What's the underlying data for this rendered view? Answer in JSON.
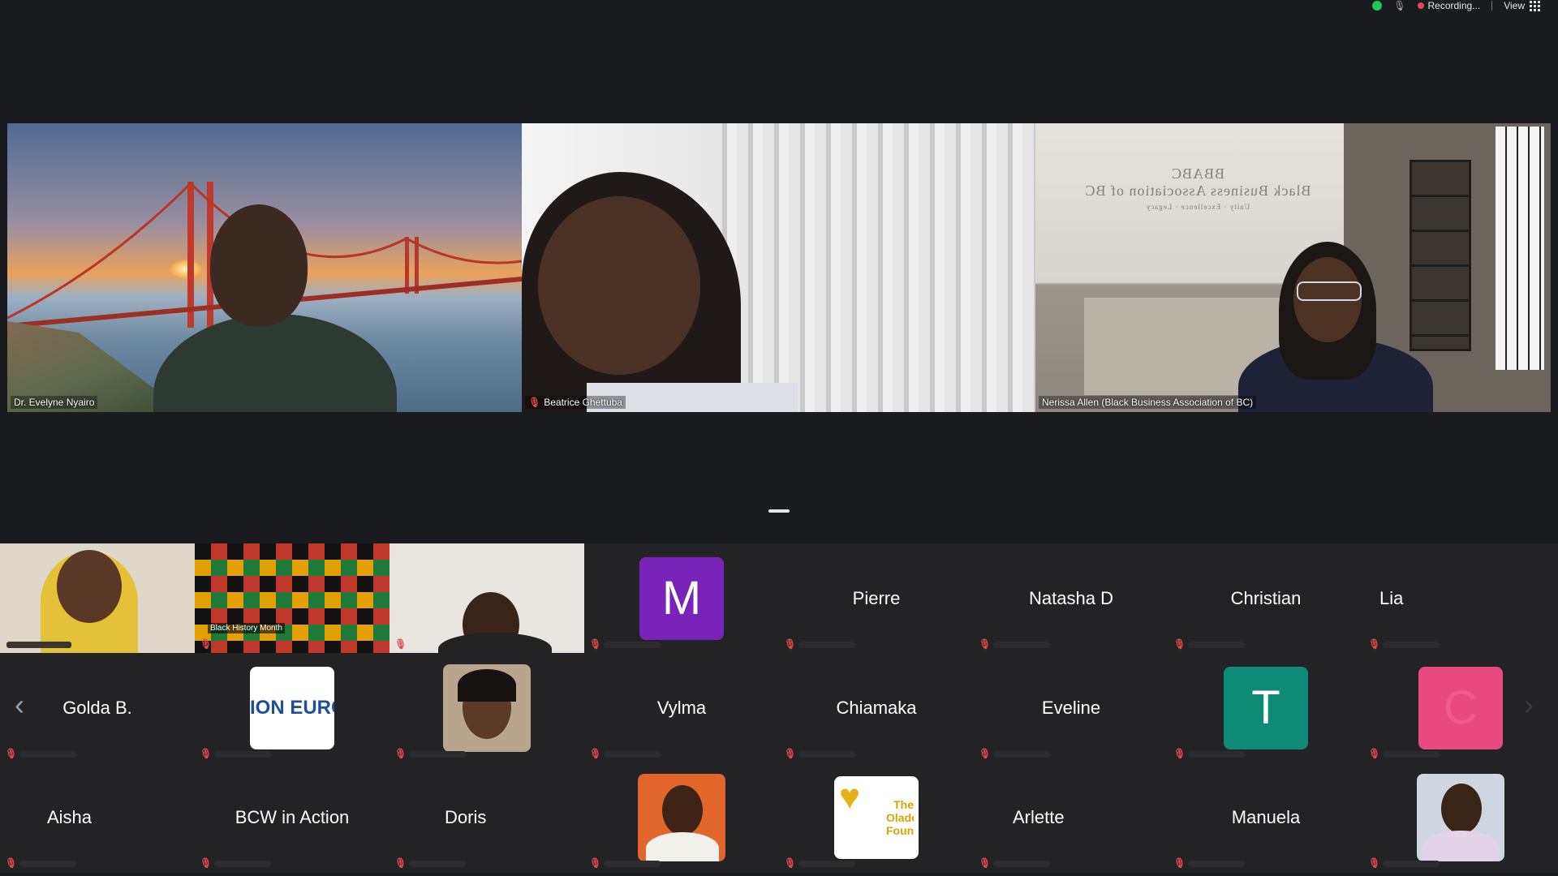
{
  "topbar": {
    "recording": "Recording...",
    "view": "View"
  },
  "speakers": [
    {
      "name": "Dr. Evelyne Nyairo",
      "muted": false
    },
    {
      "name": "Beatrice Ghettuba",
      "muted": true
    },
    {
      "name": "Nerissa Allen (Black Business Association of BC)",
      "muted": false,
      "active": true
    }
  ],
  "scene3_logo": {
    "line1": "BBABC",
    "line2": "Black Business Association of BC",
    "line3": "Unity · Excellence · Legacy"
  },
  "gallery": {
    "row1": [
      {
        "type": "video"
      },
      {
        "type": "video",
        "label": "Black History Month"
      },
      {
        "type": "video"
      },
      {
        "type": "initial",
        "initial": "M",
        "color": "#7a23b8"
      },
      {
        "type": "name",
        "name": "Pierre"
      },
      {
        "type": "name",
        "name": "Natasha D"
      },
      {
        "type": "name",
        "name": "Christian"
      },
      {
        "type": "name",
        "name": "Lia"
      }
    ],
    "row2": [
      {
        "type": "name",
        "name": "Golda B."
      },
      {
        "type": "logo",
        "text": "ION EURC"
      },
      {
        "type": "photo"
      },
      {
        "type": "name",
        "name": "Vylma"
      },
      {
        "type": "name",
        "name": "Chiamaka"
      },
      {
        "type": "name",
        "name": "Eveline"
      },
      {
        "type": "initial",
        "initial": "T",
        "color": "#0f8a76"
      },
      {
        "type": "initial",
        "initial": "C",
        "color": "#e84a7f"
      }
    ],
    "row3": [
      {
        "type": "name",
        "name": "Aisha"
      },
      {
        "type": "name",
        "name": "BCW in Action"
      },
      {
        "type": "name",
        "name": "Doris"
      },
      {
        "type": "photo"
      },
      {
        "type": "logo2",
        "text": "The Olade Found"
      },
      {
        "type": "name",
        "name": "Arlette"
      },
      {
        "type": "name",
        "name": "Manuela"
      },
      {
        "type": "photo"
      }
    ]
  },
  "colors": {
    "accent_active": "#2fcc4a",
    "muted": "#e5484d",
    "bg": "#1a1b1f"
  }
}
